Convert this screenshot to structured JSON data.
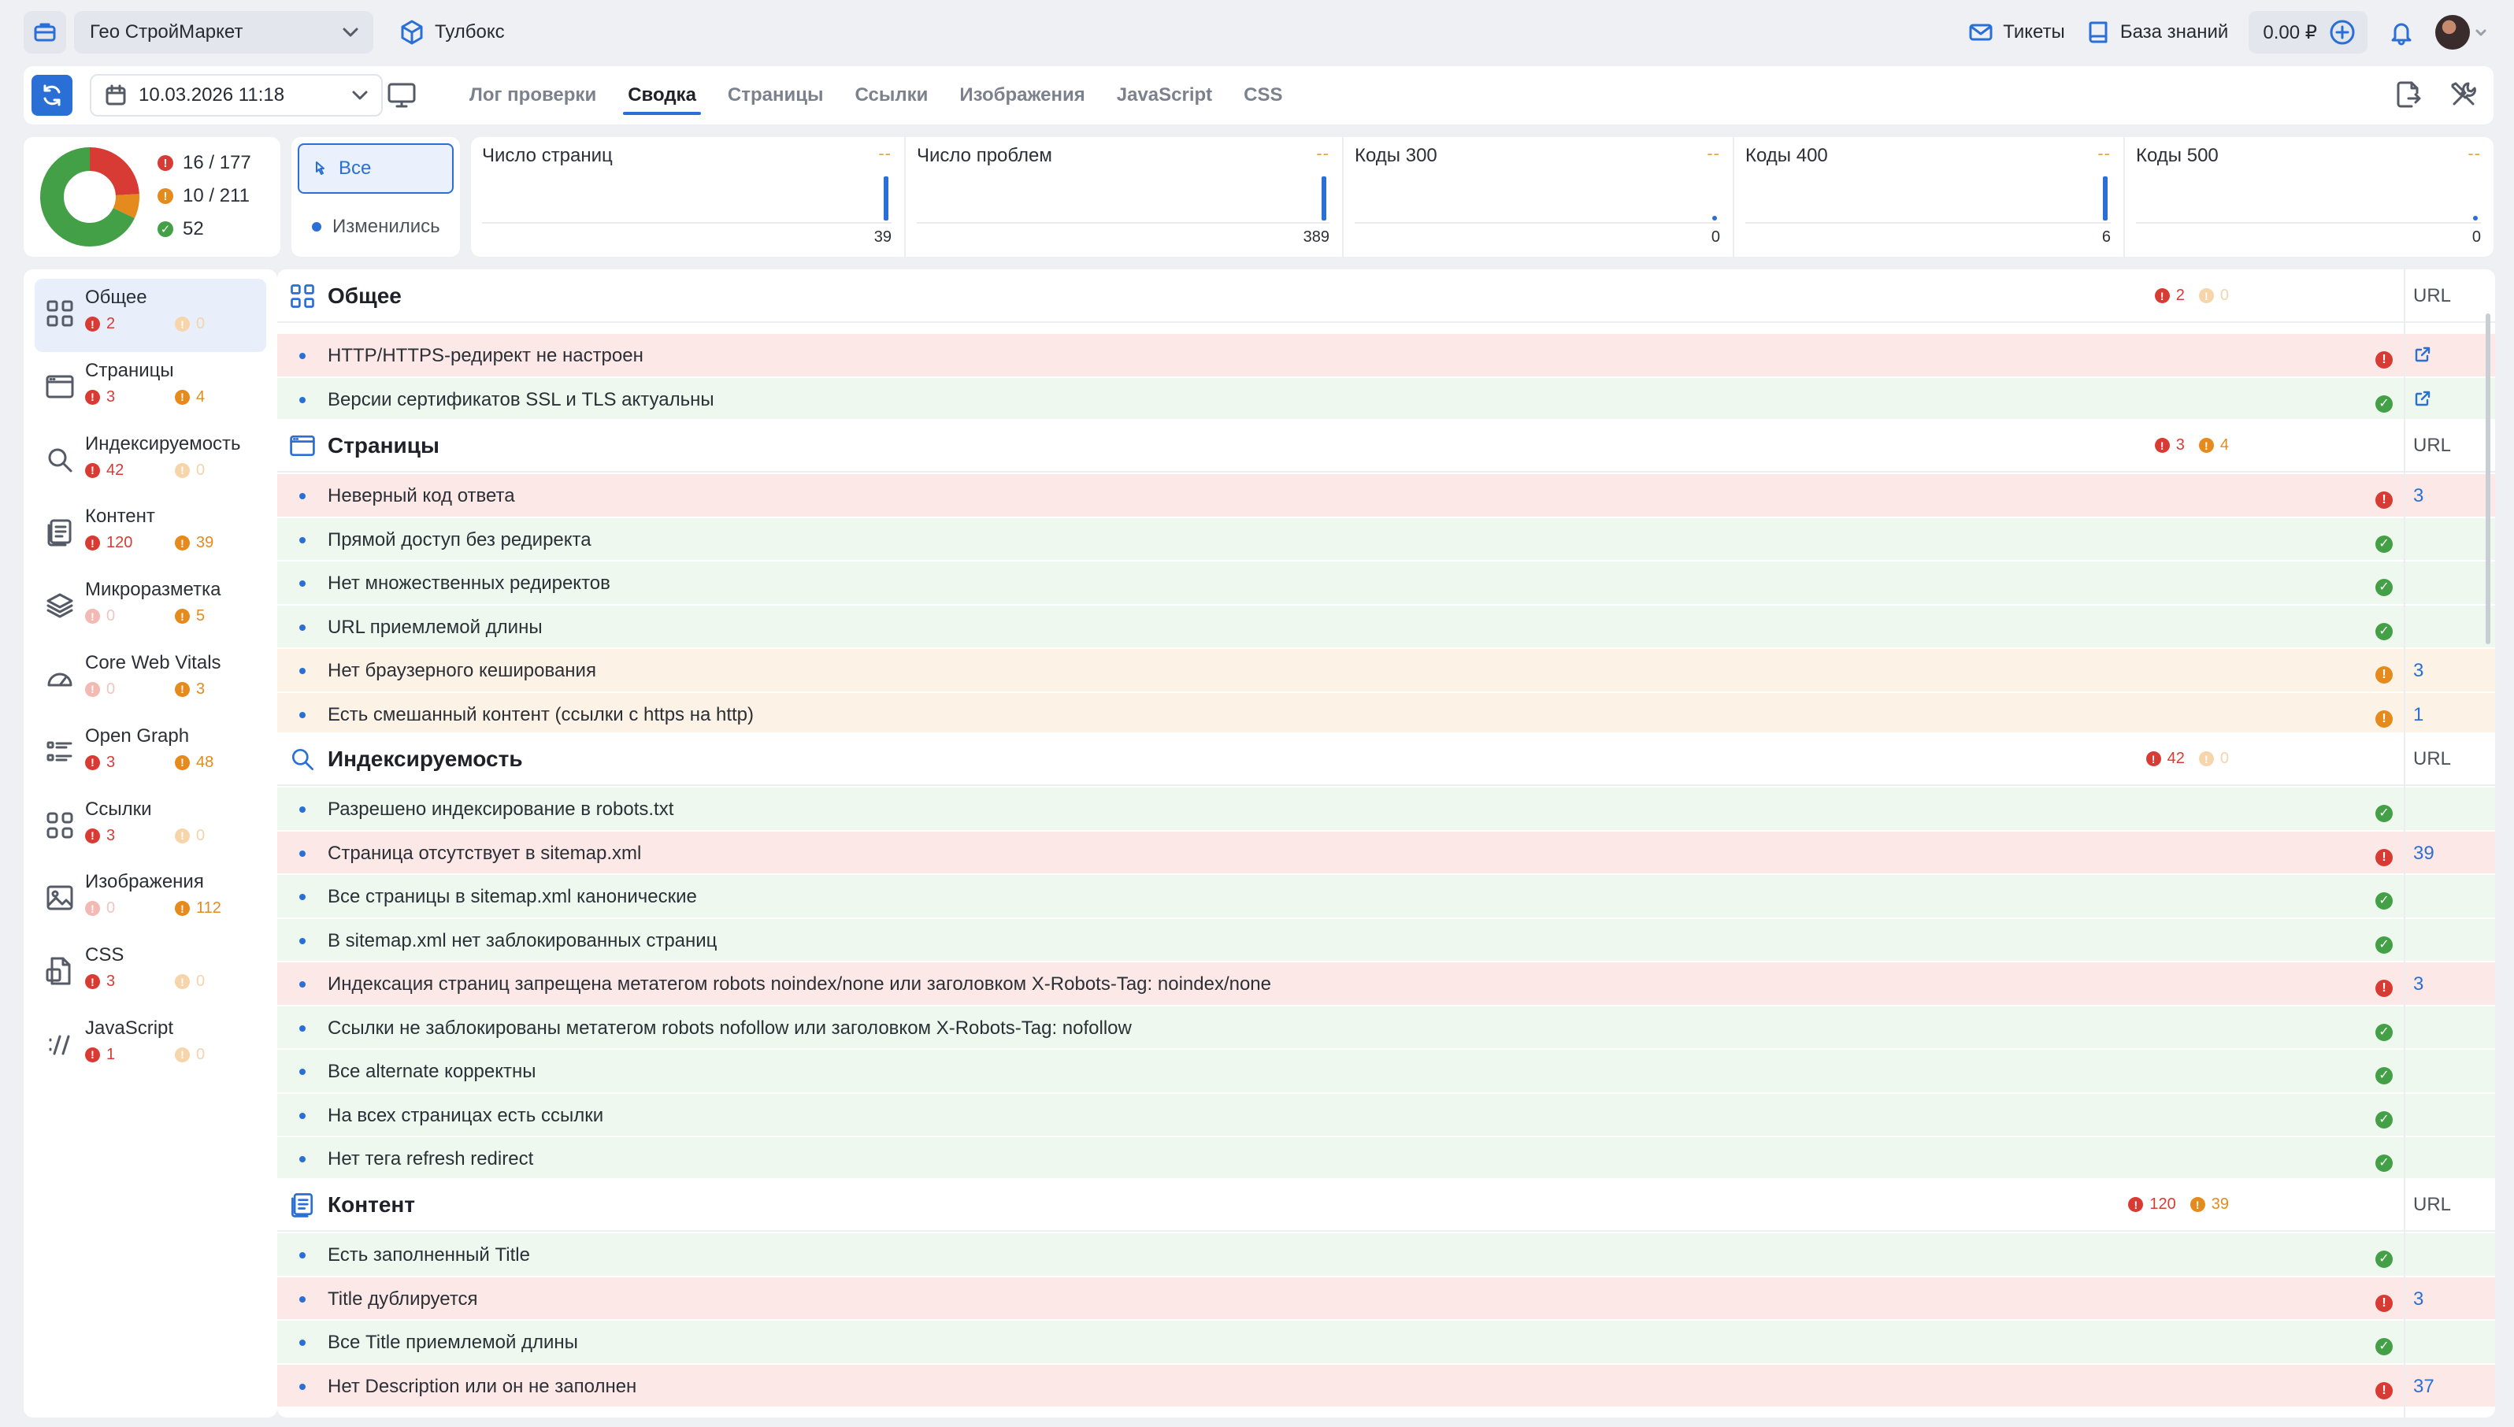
{
  "topbar": {
    "project": "Гео СтройМаркет",
    "toolbox": "Тулбокс",
    "tickets": "Тикеты",
    "knowledge_base": "База знаний",
    "balance": "0.00 ₽"
  },
  "navbar": {
    "date": "10.03.2026 11:18",
    "tabs": [
      {
        "label": "Лог проверки"
      },
      {
        "label": "Сводка"
      },
      {
        "label": "Страницы"
      },
      {
        "label": "Ссылки"
      },
      {
        "label": "Изображения"
      },
      {
        "label": "JavaScript"
      },
      {
        "label": "CSS"
      }
    ],
    "active_tab": "Сводка"
  },
  "summary": {
    "errors": "16 / 177",
    "warnings": "10 / 211",
    "ok": "52",
    "donut": {
      "error_share": 0.24,
      "warning_share": 0.08,
      "ok_share": 0.68
    },
    "colors": {
      "error": "#d83b33",
      "warning": "#e58a1d",
      "ok": "#43a047",
      "accent": "#2a6fd6"
    }
  },
  "filters": {
    "all": "Все",
    "changed": "Изменились"
  },
  "metrics": [
    {
      "title": "Число страниц",
      "dash": "--",
      "value": "39",
      "bar_level": 1.0
    },
    {
      "title": "Число проблем",
      "dash": "--",
      "value": "389",
      "bar_level": 1.0
    },
    {
      "title": "Коды 300",
      "dash": "--",
      "value": "0",
      "bar_level": 0.0
    },
    {
      "title": "Коды 400",
      "dash": "--",
      "value": "6",
      "bar_level": 1.0
    },
    {
      "title": "Коды 500",
      "dash": "--",
      "value": "0",
      "bar_level": 0.0
    }
  ],
  "sidebar": {
    "items": [
      {
        "label": "Общее",
        "errors": "2",
        "warnings": "0",
        "icon": "grid-icon"
      },
      {
        "label": "Страницы",
        "errors": "3",
        "warnings": "4",
        "icon": "browser-window-icon"
      },
      {
        "label": "Индексируемость",
        "errors": "42",
        "warnings": "0",
        "icon": "search-icon"
      },
      {
        "label": "Контент",
        "errors": "120",
        "warnings": "39",
        "icon": "documents-icon"
      },
      {
        "label": "Микроразметка",
        "errors": "0",
        "warnings": "5",
        "icon": "layers-icon"
      },
      {
        "label": "Core Web Vitals",
        "errors": "0",
        "warnings": "3",
        "icon": "speedometer-icon"
      },
      {
        "label": "Open Graph",
        "errors": "3",
        "warnings": "48",
        "icon": "list-icon"
      },
      {
        "label": "Ссылки",
        "errors": "3",
        "warnings": "0",
        "icon": "link-grid-icon"
      },
      {
        "label": "Изображения",
        "errors": "0",
        "warnings": "112",
        "icon": "image-icon"
      },
      {
        "label": "CSS",
        "errors": "3",
        "warnings": "0",
        "icon": "css-file-icon"
      },
      {
        "label": "JavaScript",
        "errors": "1",
        "warnings": "0",
        "icon": "code-icon"
      }
    ]
  },
  "main": {
    "url_header": "URL",
    "sections": [
      {
        "title": "Общее",
        "errors": "2",
        "warnings": "0",
        "rows": [
          {
            "text": "HTTP/HTTPS-редирект не настроен",
            "status": "error",
            "url": "",
            "link": true
          },
          {
            "text": "Версии сертификатов SSL и TLS актуальны",
            "status": "ok",
            "url": "",
            "link": true
          }
        ]
      },
      {
        "title": "Страницы",
        "errors": "3",
        "warnings": "4",
        "rows": [
          {
            "text": "Неверный код ответа",
            "status": "error",
            "url": "3"
          },
          {
            "text": "Прямой доступ без редиректа",
            "status": "ok",
            "url": ""
          },
          {
            "text": "Нет множественных редиректов",
            "status": "ok",
            "url": ""
          },
          {
            "text": "URL приемлемой длины",
            "status": "ok",
            "url": ""
          },
          {
            "text": "Нет браузерного кеширования",
            "status": "warn",
            "url": "3"
          },
          {
            "text": "Есть смешанный контент (ссылки с https на http)",
            "status": "warn",
            "url": "1"
          }
        ]
      },
      {
        "title": "Индексируемость",
        "errors": "42",
        "warnings": "0",
        "rows": [
          {
            "text": "Разрешено индексирование в robots.txt",
            "status": "ok",
            "url": ""
          },
          {
            "text": "Страница отсутствует в sitemap.xml",
            "status": "error",
            "url": "39"
          },
          {
            "text": "Все страницы в sitemap.xml канонические",
            "status": "ok",
            "url": ""
          },
          {
            "text": "В sitemap.xml нет заблокированных страниц",
            "status": "ok",
            "url": ""
          },
          {
            "text": "Индексация страниц запрещена метатегом robots noindex/none или заголовком X-Robots-Tag: noindex/none",
            "status": "error",
            "url": "3"
          },
          {
            "text": "Ссылки не заблокированы метатегом robots nofollow или заголовком X-Robots-Tag: nofollow",
            "status": "ok",
            "url": ""
          },
          {
            "text": "Все alternate корректны",
            "status": "ok",
            "url": ""
          },
          {
            "text": "На всех страницах есть ссылки",
            "status": "ok",
            "url": ""
          },
          {
            "text": "Нет тега refresh redirect",
            "status": "ok",
            "url": ""
          }
        ]
      },
      {
        "title": "Контент",
        "errors": "120",
        "warnings": "39",
        "rows": [
          {
            "text": "Есть заполненный Title",
            "status": "ok",
            "url": ""
          },
          {
            "text": "Title дублируется",
            "status": "error",
            "url": "3"
          },
          {
            "text": "Все Title приемлемой длины",
            "status": "ok",
            "url": ""
          },
          {
            "text": "Нет Description или он не заполнен",
            "status": "error",
            "url": "37"
          }
        ]
      }
    ]
  }
}
